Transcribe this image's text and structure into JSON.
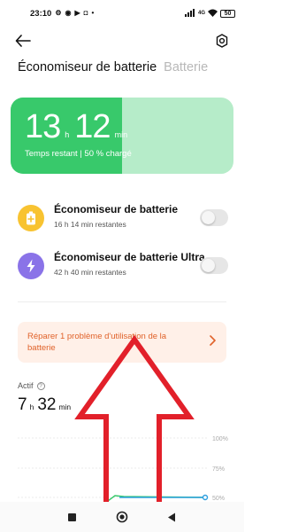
{
  "status_bar": {
    "time": "23:10",
    "icons": [
      "gear-icon",
      "recorder-icon",
      "media-icon",
      "notification-icon",
      "dot-icon"
    ],
    "signal_text": "4G",
    "battery_level": "50"
  },
  "header": {
    "back_icon": "back-arrow-icon",
    "settings_icon": "settings-icon"
  },
  "tabs": [
    {
      "label": "Économiseur de batterie",
      "active": true
    },
    {
      "label": "Batterie",
      "active": false
    }
  ],
  "time_card": {
    "hours": "13",
    "hours_unit": "h",
    "minutes": "12",
    "minutes_unit": "min",
    "subtitle": "Temps restant | 50 % chargé",
    "charge_fraction": 0.5,
    "colors": {
      "fill": "#38c96b",
      "track": "#b6ecc9"
    }
  },
  "modes": [
    {
      "title": "Économiseur de batterie",
      "subtitle": "16 h 14 min restantes",
      "icon": "battery-saver-icon",
      "icon_color": "#f8c331",
      "enabled": false
    },
    {
      "title": "Économiseur de batterie Ultra",
      "subtitle": "42 h 40 min restantes",
      "icon": "lightning-icon",
      "icon_color": "#8a73e8",
      "enabled": false
    }
  ],
  "repair": {
    "text": "Réparer 1 problème d'utilisation de la batterie",
    "chevron_icon": "chevron-right-icon",
    "color": "#e0622a"
  },
  "actif": {
    "label": "Actif",
    "help_icon": "help-icon",
    "hours": "7",
    "hours_unit": "h",
    "minutes": "32",
    "minutes_unit": "min"
  },
  "chart": {
    "y_ticks": [
      "100%",
      "75%",
      "50%"
    ],
    "line_color": "#2d9fe0",
    "charge_color": "#38c96b"
  },
  "nav_bar": {
    "icons": [
      "square-recents-icon",
      "circle-home-icon",
      "triangle-back-icon"
    ]
  },
  "annotation": {
    "arrow_color": "#e2202a"
  }
}
